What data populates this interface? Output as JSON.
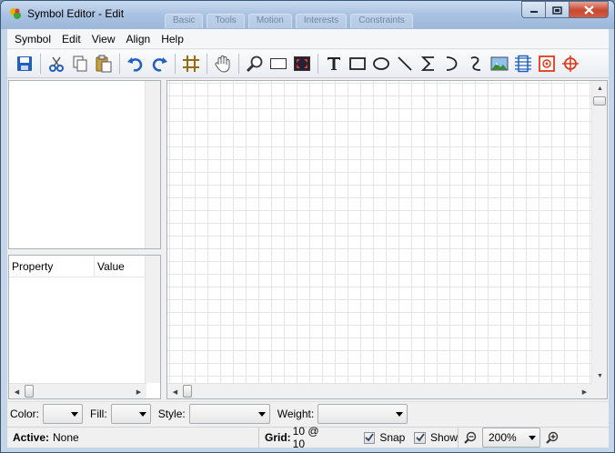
{
  "window": {
    "title": "Symbol Editor - Edit",
    "background_tabs": [
      "Basic",
      "Tools",
      "Motion",
      "Interests",
      "Constraints"
    ]
  },
  "menu": {
    "items": [
      {
        "id": "symbol",
        "label": "Symbol"
      },
      {
        "id": "edit",
        "label": "Edit"
      },
      {
        "id": "view",
        "label": "View"
      },
      {
        "id": "align",
        "label": "Align"
      },
      {
        "id": "help",
        "label": "Help"
      }
    ]
  },
  "toolbar": {
    "buttons": [
      "save-icon",
      "cut-icon",
      "copy-icon",
      "paste-icon",
      "undo-icon",
      "redo-icon",
      "grid-icon",
      "pan-hand-icon",
      "zoom-icon",
      "rectangle-select-icon",
      "fit-view-icon",
      "text-icon",
      "rectangle-icon",
      "ellipse-icon",
      "line-icon",
      "polyline-icon",
      "arc-icon",
      "curve-icon",
      "image-icon",
      "pin-connector-icon",
      "anchor-icon",
      "crosshair-icon"
    ]
  },
  "properties": {
    "col_property": "Property",
    "col_value": "Value"
  },
  "propbar": {
    "color_label": "Color:",
    "fill_label": "Fill:",
    "style_label": "Style:",
    "weight_label": "Weight:"
  },
  "status": {
    "active_label": "Active:",
    "active_value": "None",
    "grid_label": "Grid:",
    "grid_value": "10 @ 10",
    "snap_label": "Snap",
    "snap_checked": true,
    "show_label": "Show",
    "show_checked": true,
    "zoom_value": "200%"
  },
  "colors": {
    "accent_blue": "#1f5fbf",
    "close_red": "#c7472f",
    "canvas_grid": "#e4e4e4"
  }
}
